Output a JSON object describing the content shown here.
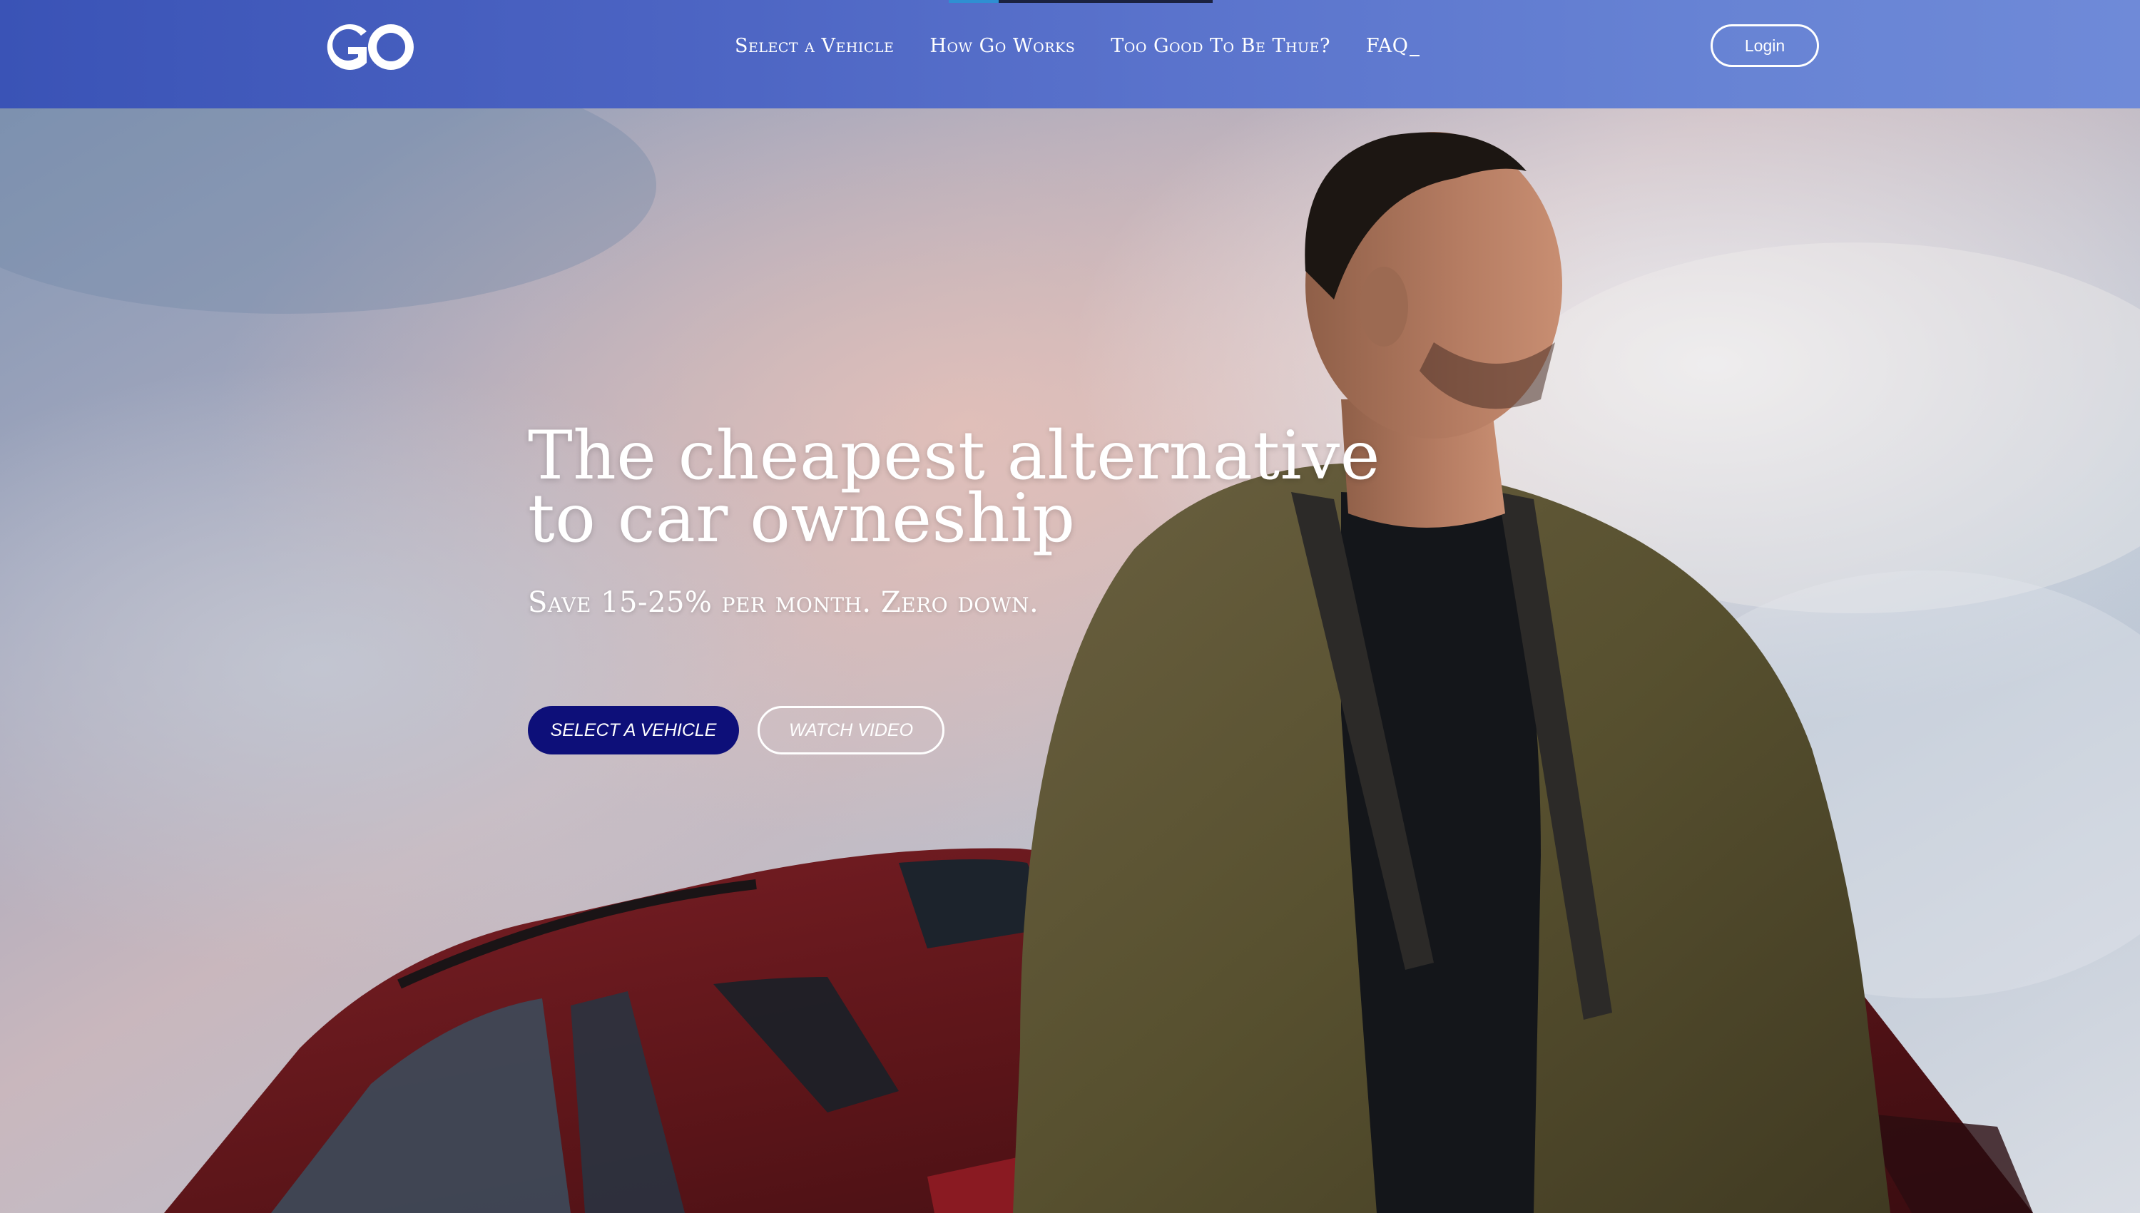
{
  "header": {
    "logo_text": "GO",
    "nav": [
      {
        "label": "Select a Vehicle"
      },
      {
        "label": "How Go Works"
      },
      {
        "label": "Too Good To Be Thue?"
      },
      {
        "label": "FAQ"
      }
    ],
    "login_label": "Login"
  },
  "hero": {
    "title_line1": "The cheapest alternative",
    "title_line2": "to car owneship",
    "subtitle": "Save 15-25% per month. Zero down.",
    "cta_primary": "SELECT A VEHICLE",
    "cta_secondary": "WATCH VIDEO"
  },
  "colors": {
    "header_start": "#3a53b6",
    "header_end": "#6f8ad8",
    "cta_primary_bg": "#0d0f79",
    "text": "#ffffff"
  },
  "icons": {
    "logo": "go-logo-icon"
  }
}
